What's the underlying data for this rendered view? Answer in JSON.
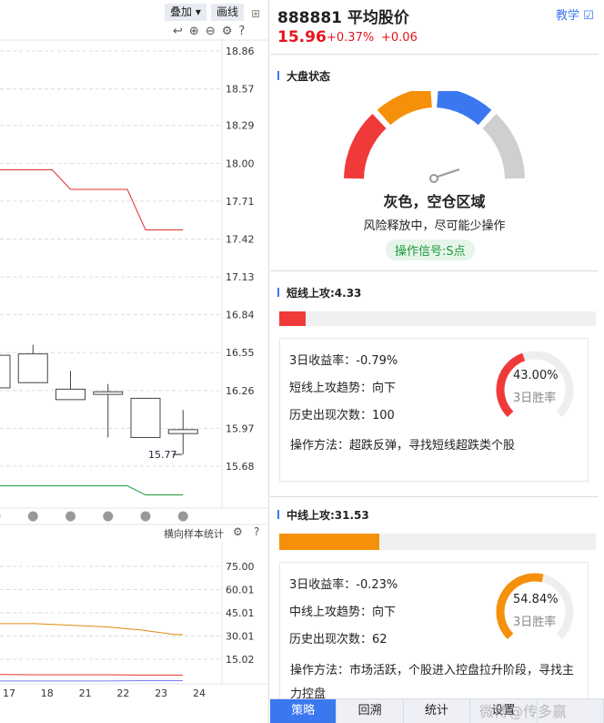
{
  "toolbar": {
    "overlay_label": "叠加",
    "draw_label": "画线"
  },
  "chart_data": [
    {
      "type": "candlestick",
      "y_ticks": [
        "18.86",
        "18.57",
        "18.29",
        "18.00",
        "17.71",
        "17.42",
        "17.13",
        "16.84",
        "16.55",
        "16.26",
        "15.97",
        "15.68"
      ],
      "ylim": [
        15.68,
        18.86
      ],
      "candles": [
        {
          "open": 16.53,
          "close": 16.28,
          "high": 16.53,
          "low": 16.28
        },
        {
          "open": 16.32,
          "close": 16.54,
          "high": 16.61,
          "low": 16.32
        },
        {
          "open": 16.27,
          "close": 16.19,
          "high": 16.41,
          "low": 16.19
        },
        {
          "open": 16.25,
          "close": 16.23,
          "high": 16.31,
          "low": 15.9
        },
        {
          "open": 16.2,
          "close": 15.9,
          "high": 16.2,
          "low": 15.9
        },
        {
          "open": 15.93,
          "close": 15.96,
          "high": 16.11,
          "low": 15.77
        }
      ],
      "low_label": "15.77",
      "series": [
        {
          "name": "red-line",
          "color": "#e03030",
          "values": [
            17.95,
            17.95,
            17.8,
            17.8,
            17.49,
            17.49
          ]
        },
        {
          "name": "green-line",
          "color": "#1a9a3a",
          "values": [
            15.53,
            15.53,
            15.53,
            15.53,
            15.46,
            15.46
          ]
        }
      ]
    },
    {
      "type": "line",
      "title": "横向样本统计",
      "y_ticks": [
        "75.00",
        "60.01",
        "45.01",
        "30.01",
        "15.02"
      ],
      "ylim": [
        15.02,
        75.0
      ],
      "x": [
        "17",
        "18",
        "21",
        "22",
        "23",
        "24"
      ],
      "series": [
        {
          "name": "orange",
          "color": "#e08a10",
          "values": [
            38,
            38,
            37,
            36,
            34,
            31
          ]
        },
        {
          "name": "red",
          "color": "#f03030",
          "values": [
            5.2,
            5,
            5,
            5,
            4.8,
            4.8
          ]
        },
        {
          "name": "blue",
          "color": "#7a7af0",
          "values": [
            1,
            1,
            1,
            1,
            1.2,
            1.2
          ]
        }
      ]
    }
  ],
  "stock": {
    "code_name": "888881 平均股价",
    "price": "15.96",
    "pct": "+0.37%",
    "chg": "+0.06",
    "teach": "教学"
  },
  "market": {
    "title": "大盘状态",
    "status": "灰色，空仓区域",
    "desc": "风险释放中，尽可能少操作",
    "signal": "操作信号:S点"
  },
  "short": {
    "title": "短线上攻:4.33",
    "progress": 4.33,
    "ret": "3日收益率：-0.79%",
    "trend": "短线上攻趋势：向下",
    "count": "历史出现次数：100",
    "method": "操作方法：超跌反弹，寻找短线超跌类个股",
    "win": "43.00%",
    "win_label": "3日胜率",
    "win_value": 43.0,
    "color": "#f03a3a"
  },
  "mid": {
    "title": "中线上攻:31.53",
    "progress": 31.53,
    "ret": "3日收益率：-0.23%",
    "trend": "中线上攻趋势：向下",
    "count": "历史出现次数：62",
    "method": "操作方法：市场活跃，个股进入控盘拉升阶段，寻找主力控盘",
    "win": "54.84%",
    "win_label": "3日胜率",
    "win_value": 54.84,
    "color": "#f5900a"
  },
  "tabs": [
    "策略",
    "回溯",
    "统计",
    "设置",
    ""
  ],
  "watermark": "微博@传多赢"
}
